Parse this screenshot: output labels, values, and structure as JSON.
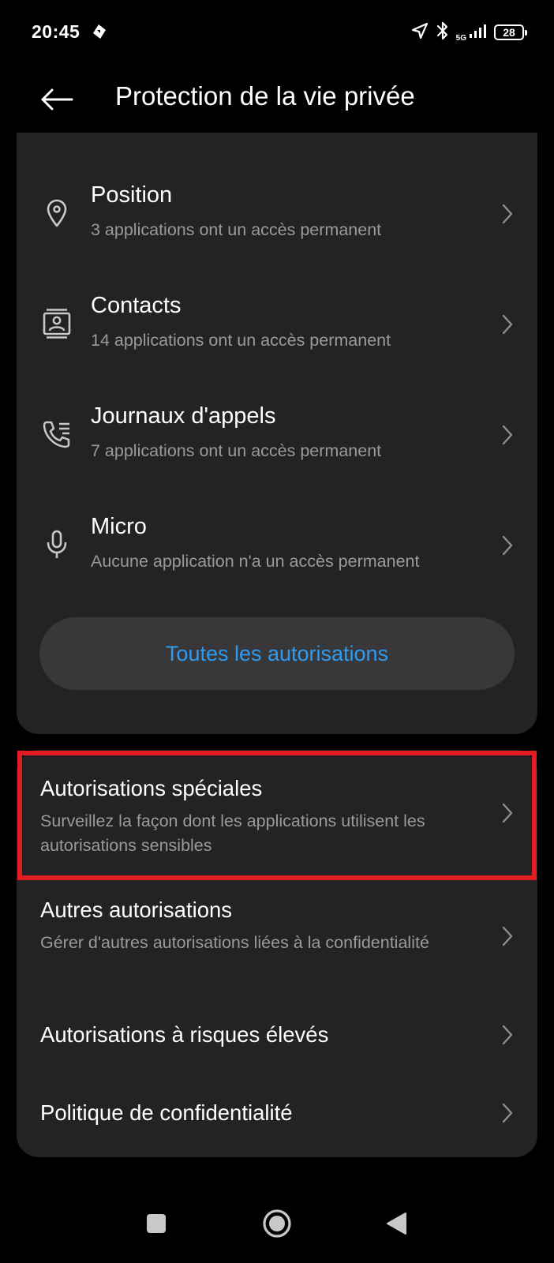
{
  "status_bar": {
    "time": "20:45",
    "network": "5G",
    "battery": "28"
  },
  "header": {
    "title": "Protection de la vie privée"
  },
  "permissions": [
    {
      "icon": "location-pin-icon",
      "title": "Position",
      "subtitle": "3 applications ont un accès permanent"
    },
    {
      "icon": "contacts-icon",
      "title": "Contacts",
      "subtitle": "14 applications ont un accès permanent"
    },
    {
      "icon": "call-log-icon",
      "title": "Journaux d'appels",
      "subtitle": "7 applications ont un accès permanent"
    },
    {
      "icon": "microphone-icon",
      "title": "Micro",
      "subtitle": "Aucune application n'a un accès permanent"
    }
  ],
  "all_permissions_button": "Toutes les autorisations",
  "options": [
    {
      "title": "Autorisations spéciales",
      "subtitle": "Surveillez la façon dont les applications utilisent les autorisations sensibles",
      "highlighted": true
    },
    {
      "title": "Autres autorisations",
      "subtitle": "Gérer d'autres autorisations liées à la confidentialité"
    },
    {
      "title": "Autorisations à risques élevés"
    },
    {
      "title": "Politique de confidentialité"
    }
  ],
  "colors": {
    "background": "#000000",
    "card": "#232325",
    "accent": "#2f9bf0",
    "highlight": "#e31b23",
    "secondary_text": "#9a9a9d"
  }
}
